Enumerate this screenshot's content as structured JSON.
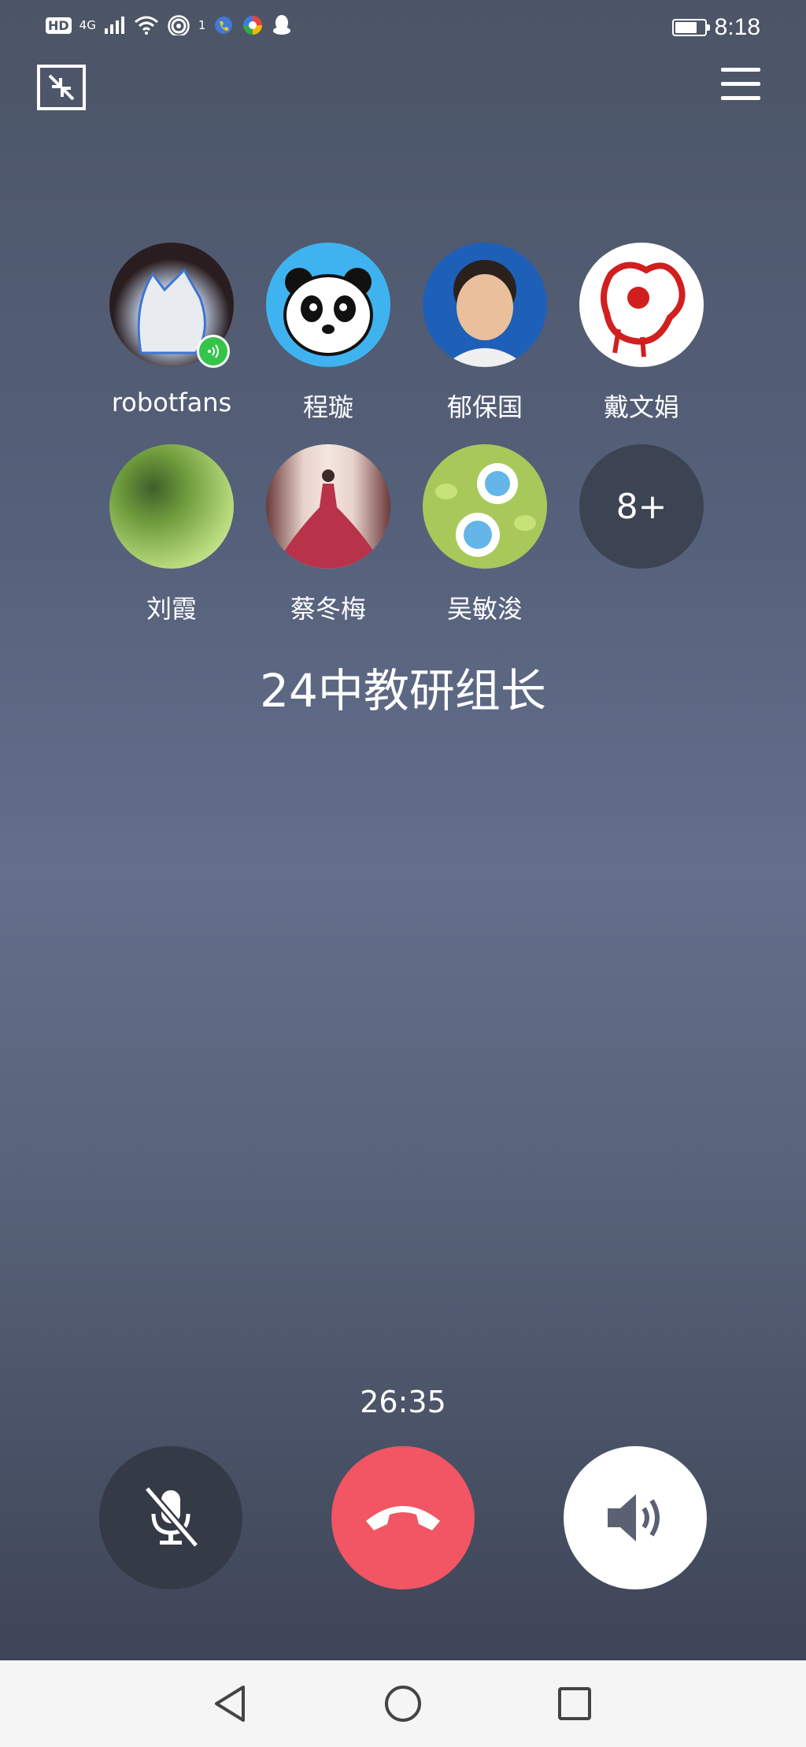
{
  "status_bar": {
    "network_badge": "HD",
    "network_type": "4G",
    "signal_badge": "1",
    "time": "8:18",
    "battery_level": 0.75
  },
  "icons": {
    "minimize": "minimize-window-icon",
    "menu": "hamburger-menu-icon",
    "mute": "microphone-muted-icon",
    "hangup": "hang-up-phone-icon",
    "speaker": "speaker-volume-icon"
  },
  "members": [
    {
      "name": "robotfans",
      "speaking": true,
      "avatar_color": "#2a1d1f"
    },
    {
      "name": "程璇",
      "speaking": false,
      "avatar_color": "#3fb3f0"
    },
    {
      "name": "郁保国",
      "speaking": false,
      "avatar_color": "#1e5fb8"
    },
    {
      "name": "戴文娟",
      "speaking": false,
      "avatar_color": "#ffffff"
    },
    {
      "name": "刘霞",
      "speaking": false,
      "avatar_color": "#8cbf4b"
    },
    {
      "name": "蔡冬梅",
      "speaking": false,
      "avatar_color": "#b8334a"
    },
    {
      "name": "吴敏浚",
      "speaking": false,
      "avatar_color": "#a8c95a"
    }
  ],
  "more_members": "8+",
  "group_name": "24中教研组长",
  "call_duration": "26:35",
  "colors": {
    "hangup": "#f25563",
    "mute_bg": "#353a47",
    "speaker_bg": "#ffffff",
    "speaking_indicator": "#35c44a"
  }
}
